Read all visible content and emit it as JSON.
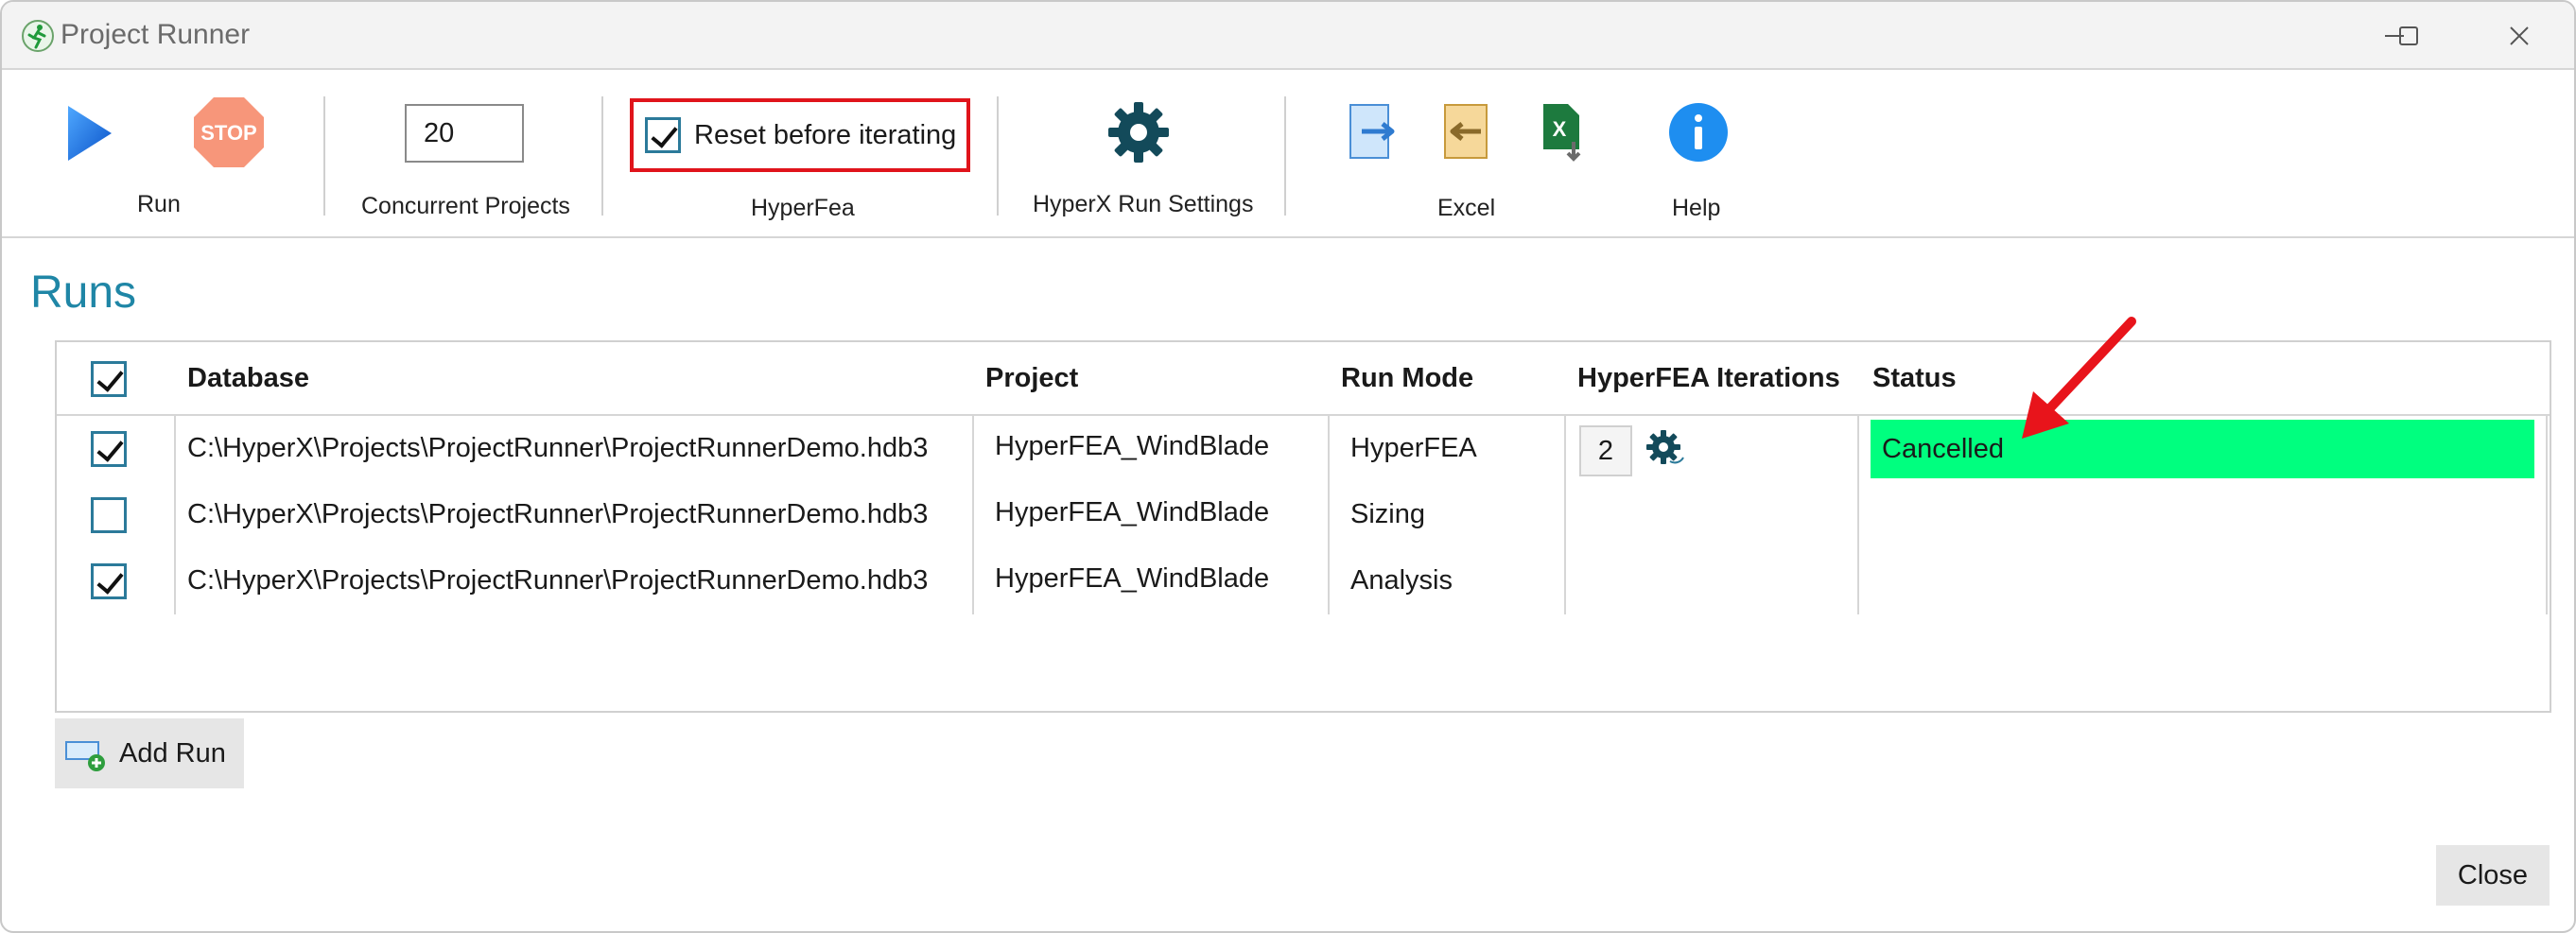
{
  "window": {
    "title": "Project Runner"
  },
  "toolbar": {
    "run_label": "Run",
    "stop_icon_text": "STOP",
    "concurrent_value": "20",
    "concurrent_label": "Concurrent Projects",
    "reset_label": "Reset before iterating",
    "reset_checked": true,
    "hyperfea_label": "HyperFea",
    "settings_label": "HyperX Run Settings",
    "excel_label": "Excel",
    "help_label": "Help"
  },
  "runs": {
    "heading": "Runs",
    "columns": [
      "Database",
      "Project",
      "Run Mode",
      "HyperFEA Iterations",
      "Status"
    ],
    "rows": [
      {
        "checked": true,
        "database": "C:\\HyperX\\Projects\\ProjectRunner\\ProjectRunnerDemo.hdb3",
        "project": "HyperFEA_WindBlade",
        "mode": "HyperFEA",
        "iterations": "2",
        "status": "Cancelled"
      },
      {
        "checked": false,
        "database": "C:\\HyperX\\Projects\\ProjectRunner\\ProjectRunnerDemo.hdb3",
        "project": "HyperFEA_WindBlade",
        "mode": "Sizing",
        "iterations": "",
        "status": ""
      },
      {
        "checked": true,
        "database": "C:\\HyperX\\Projects\\ProjectRunner\\ProjectRunnerDemo.hdb3",
        "project": "HyperFEA_WindBlade",
        "mode": "Analysis",
        "iterations": "",
        "status": ""
      }
    ],
    "add_run_label": "Add Run"
  },
  "footer": {
    "close_label": "Close"
  },
  "colors": {
    "accent": "#1f86a6",
    "status_cancelled": "#00ff7f",
    "highlight_border": "#e0141b",
    "arrow": "#e8141b"
  }
}
